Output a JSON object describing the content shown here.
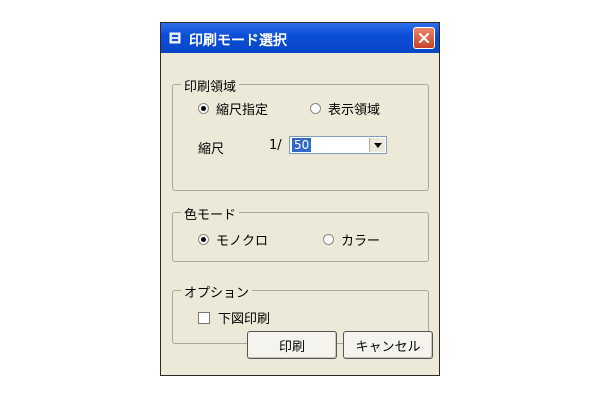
{
  "window": {
    "title": "印刷モード選択"
  },
  "print_area": {
    "legend": "印刷領域",
    "options": [
      {
        "label": "縮尺指定",
        "selected": true
      },
      {
        "label": "表示領域",
        "selected": false
      }
    ],
    "scale_label": "縮尺",
    "scale_prefix": "1/",
    "scale_value": "50"
  },
  "color_mode": {
    "legend": "色モード",
    "options": [
      {
        "label": "モノクロ",
        "selected": true
      },
      {
        "label": "カラー",
        "selected": false
      }
    ]
  },
  "options_group": {
    "legend": "オプション",
    "checkbox_label": "下図印刷",
    "checked": false
  },
  "buttons": {
    "print": "印刷",
    "cancel": "キャンセル"
  },
  "icons": {
    "title": "window-app-icon",
    "close": "close-icon",
    "dropdown": "chevron-down-icon"
  },
  "colors": {
    "titlebar": "#0a4fd6",
    "close": "#c8432a",
    "dialog_bg": "#ece9d8",
    "selection": "#316ac5"
  }
}
